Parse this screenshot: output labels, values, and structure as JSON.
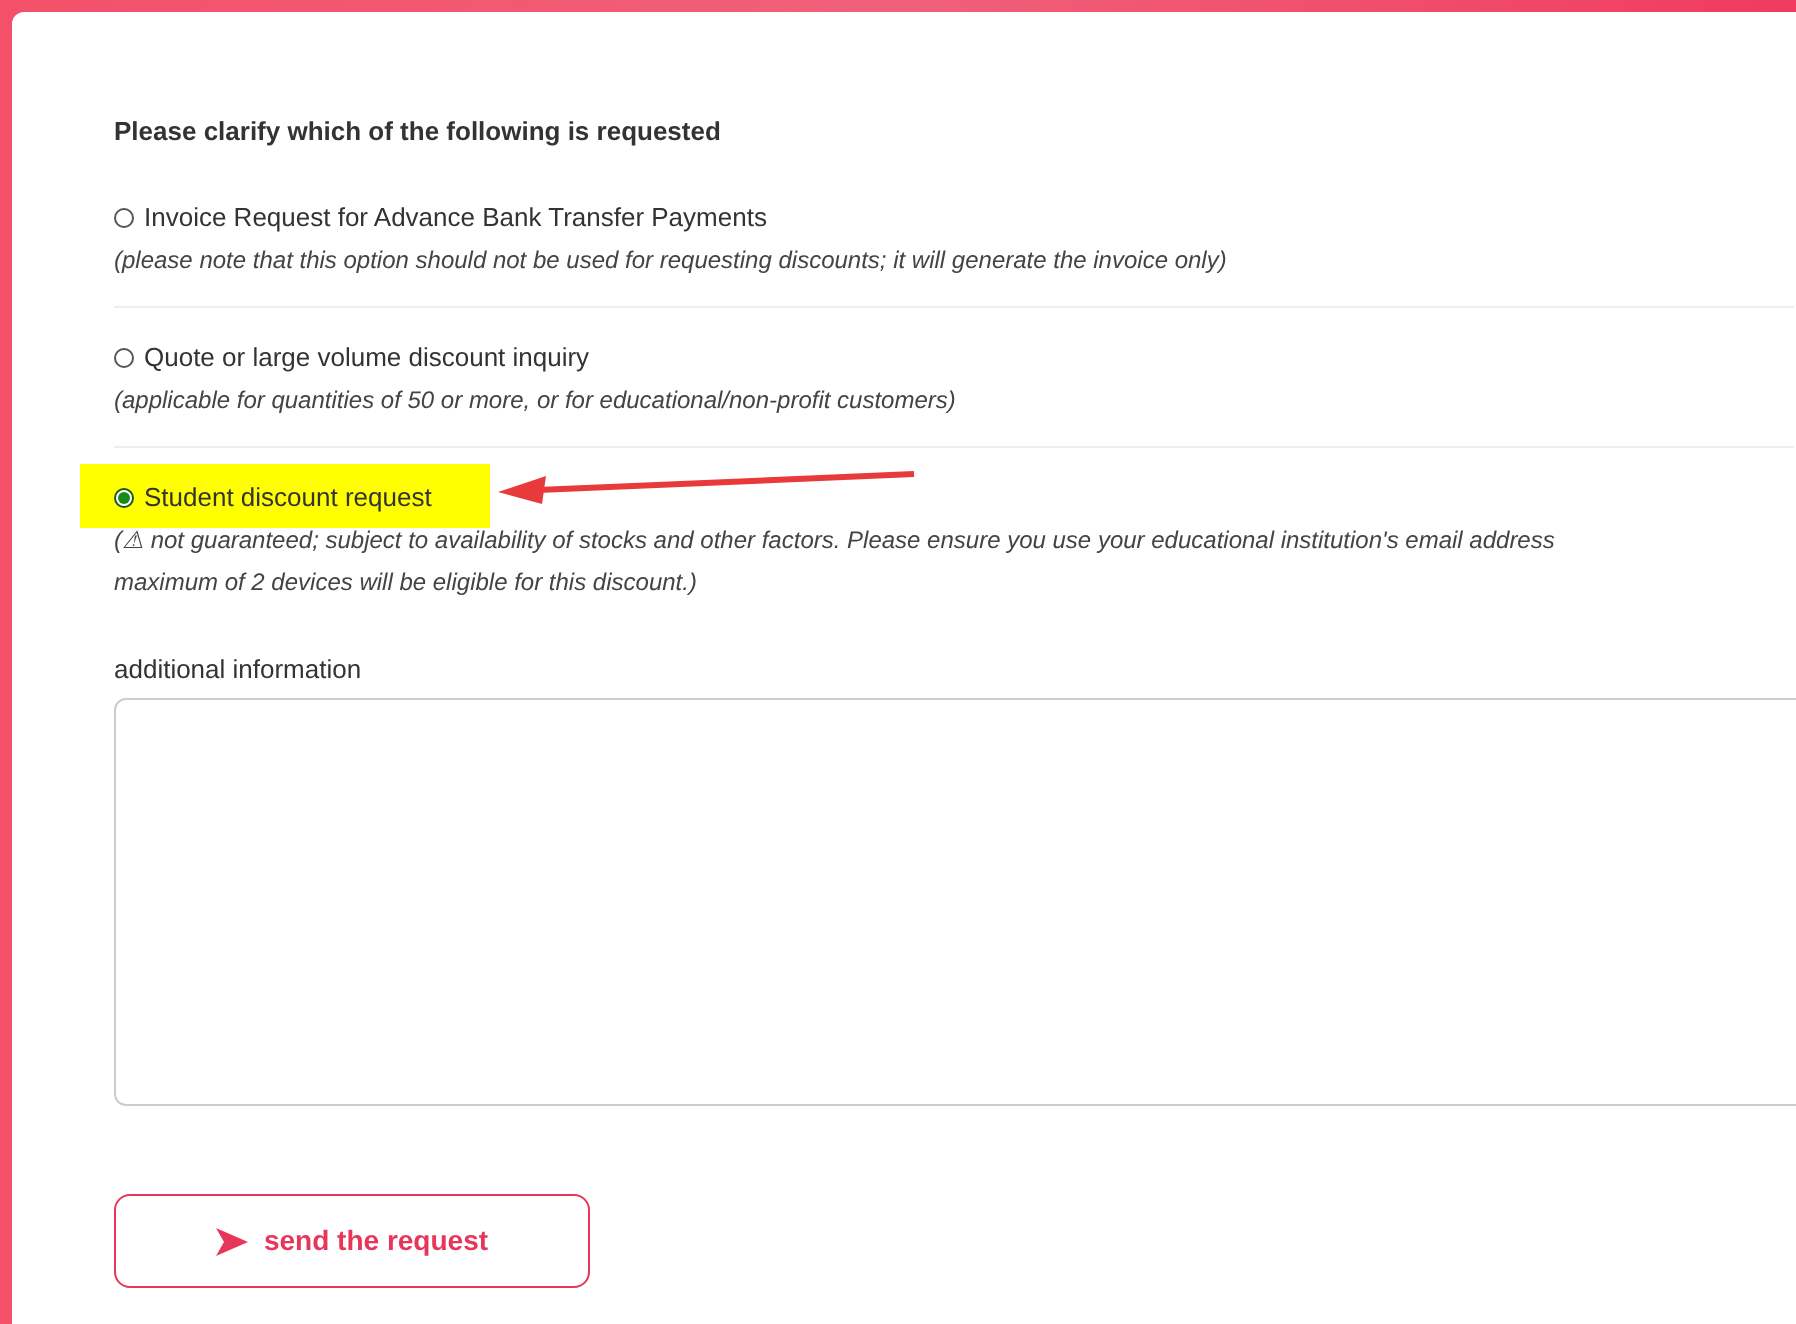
{
  "question": "Please clarify which of the following is requested",
  "options": [
    {
      "label": "Invoice Request for Advance Bank Transfer Payments",
      "selected": false,
      "highlighted": false,
      "note_lines": [
        "(please note that this option should not be used for requesting discounts; it will generate the invoice only)"
      ]
    },
    {
      "label": "Quote or large volume discount inquiry",
      "selected": false,
      "highlighted": false,
      "note_lines": [
        "(applicable for quantities of 50 or more, or for educational/non-profit customers)"
      ]
    },
    {
      "label": "Student discount request",
      "selected": true,
      "highlighted": true,
      "note_lines": [
        "(⚠ not guaranteed; subject to availability of stocks and other factors. Please ensure you use your educational institution's email address",
        "maximum of 2 devices will be eligible for this discount.)"
      ]
    }
  ],
  "additional": {
    "label": "additional information"
  },
  "submit": {
    "label": "send the request"
  }
}
